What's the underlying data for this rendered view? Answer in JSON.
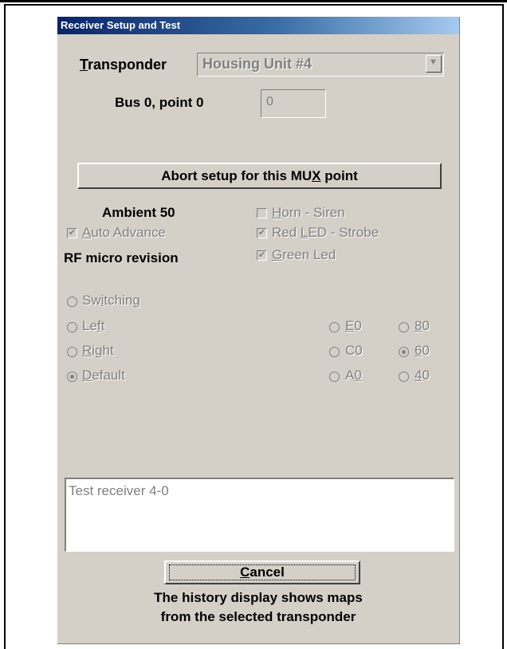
{
  "window": {
    "title": "Receiver Setup and Test"
  },
  "transponder": {
    "label_mnemonic": "T",
    "label_rest": "ransponder",
    "selected": "Housing Unit #4"
  },
  "bus_point": {
    "label": "Bus 0, point 0",
    "value": "0"
  },
  "abort_button": {
    "pre": "Abort setup for this MU",
    "mnemonic": "X",
    "post": " point"
  },
  "ambient": {
    "label": "Ambient 50"
  },
  "auto_advance": {
    "mnemonic": "A",
    "rest": "uto Advance",
    "checked": true
  },
  "rf_micro": {
    "label": "RF micro revision"
  },
  "horn_siren": {
    "mnemonic": "H",
    "rest": "orn - Siren",
    "checked": false
  },
  "red_led": {
    "pre": "Red ",
    "mnemonic": "L",
    "rest": "ED - Strobe",
    "checked": true
  },
  "green_led": {
    "mnemonic": "G",
    "rest": "reen Led",
    "checked": true
  },
  "modes": [
    {
      "pre": "Sw",
      "mnemonic": "i",
      "rest": "tching",
      "selected": false
    },
    {
      "pre": "Le",
      "mnemonic": "f",
      "rest": "t",
      "selected": false
    },
    {
      "pre": "",
      "mnemonic": "R",
      "rest": "ight",
      "selected": false
    },
    {
      "pre": "",
      "mnemonic": "D",
      "rest": "efault",
      "selected": true
    }
  ],
  "codes": [
    {
      "pre": "",
      "mnemonic": "E",
      "rest": "0",
      "selected": false
    },
    {
      "pre": "",
      "mnemonic": "8",
      "rest": "0",
      "selected": false
    },
    {
      "pre": "C",
      "mnemonic": "",
      "rest": "0",
      "selected": false
    },
    {
      "pre": "",
      "mnemonic": "6",
      "rest": "0",
      "selected": true
    },
    {
      "pre": "A",
      "mnemonic": "0",
      "rest": "",
      "selected": false
    },
    {
      "pre": "",
      "mnemonic": "4",
      "rest": "0",
      "selected": false
    }
  ],
  "log": {
    "text": "Test receiver 4-0"
  },
  "cancel_button": {
    "mnemonic": "C",
    "rest": "ancel"
  },
  "footer": {
    "line1": "The history display shows maps",
    "line2": "from the selected transponder"
  }
}
